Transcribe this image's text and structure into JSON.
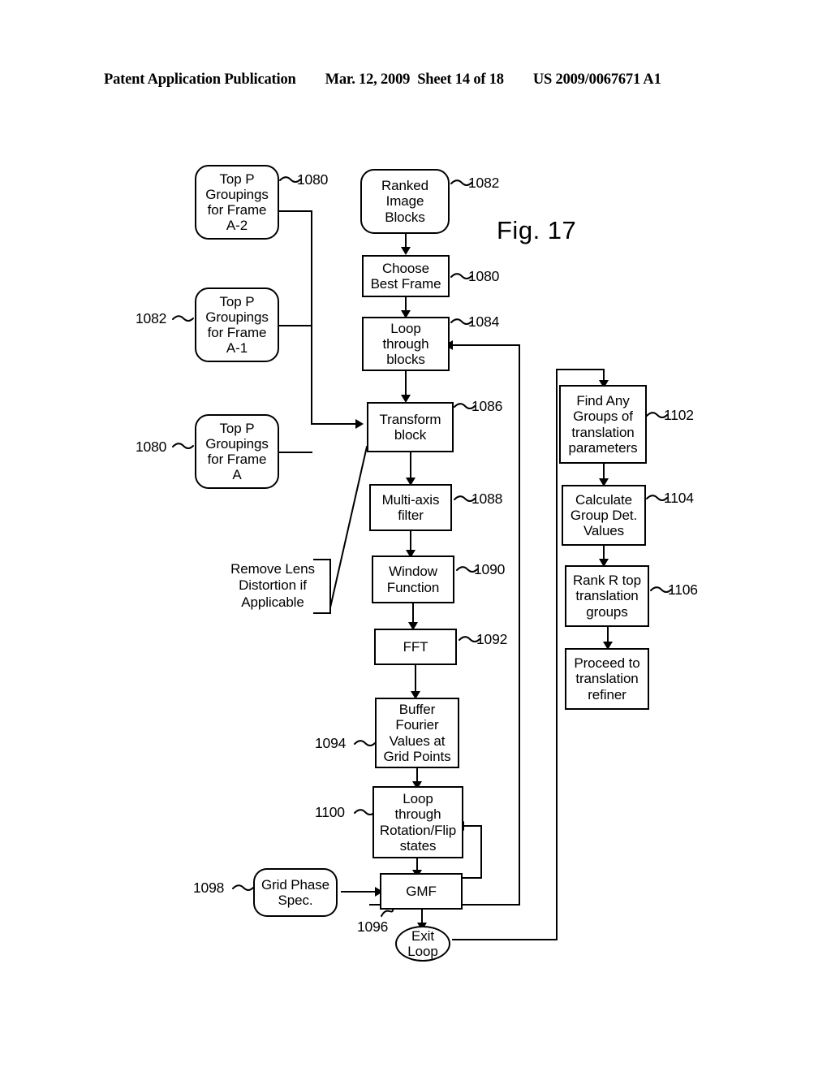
{
  "header": {
    "publication": "Patent Application Publication",
    "date": "Mar. 12, 2009",
    "sheet": "Sheet 14 of 18",
    "patent_number": "US 2009/0067671 A1"
  },
  "figure": {
    "label": "Fig. 17"
  },
  "nodes": {
    "top_p_a2": {
      "text": "Top P\nGroupings\nfor Frame\nA-2",
      "ref": "1080"
    },
    "top_p_a1": {
      "text": "Top P\nGroupings\nfor Frame\nA-1",
      "ref": "1082"
    },
    "top_p_a": {
      "text": "Top P\nGroupings\nfor Frame\nA",
      "ref": "1080"
    },
    "ranked_blocks": {
      "text": "Ranked\nImage\nBlocks",
      "ref": "1082"
    },
    "choose_best": {
      "text": "Choose\nBest Frame",
      "ref": "1080"
    },
    "loop_blocks": {
      "text": "Loop\nthrough\nblocks",
      "ref": "1084"
    },
    "transform_block": {
      "text": "Transform\nblock",
      "ref": "1086"
    },
    "multi_axis": {
      "text": "Multi-axis\nfilter",
      "ref": "1088"
    },
    "window_fn": {
      "text": "Window\nFunction",
      "ref": "1090"
    },
    "fft": {
      "text": "FFT",
      "ref": "1092"
    },
    "buffer_fourier": {
      "text": "Buffer\nFourier\nValues at\nGrid Points",
      "ref": "1094"
    },
    "loop_rotflip": {
      "text": "Loop\nthrough\nRotation/Flip\nstates",
      "ref": "1100"
    },
    "grid_phase": {
      "text": "Grid Phase\nSpec.",
      "ref": "1098"
    },
    "gmf": {
      "text": "GMF",
      "ref": "1096"
    },
    "exit_loop": {
      "text": "Exit\nLoop",
      "ref": ""
    },
    "find_groups": {
      "text": "Find Any\nGroups of\ntranslation\nparameters",
      "ref": "1102"
    },
    "calc_group_det": {
      "text": "Calculate\nGroup Det.\nValues",
      "ref": "1104"
    },
    "rank_r_top": {
      "text": "Rank R top\ntranslation\ngroups",
      "ref": "1106"
    },
    "proceed_refiner": {
      "text": "Proceed to\ntranslation\nrefiner",
      "ref": ""
    }
  },
  "captions": {
    "remove_lens": "Remove Lens\nDistortion if\nApplicable"
  },
  "colors": {
    "ink": "#000000",
    "paper": "#ffffff"
  }
}
